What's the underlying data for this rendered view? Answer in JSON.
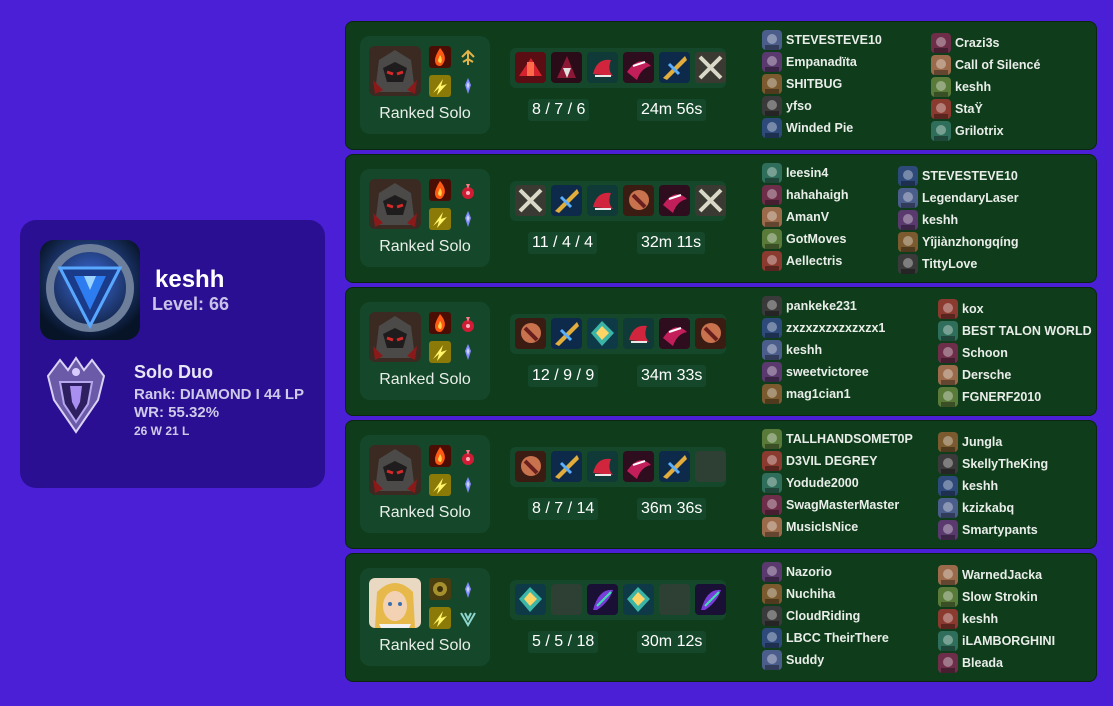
{
  "profile": {
    "name": "keshh",
    "level": "Level: 66",
    "queue": "Solo Duo",
    "rank": "Rank: DIAMOND I 44 LP",
    "winrate": "WR: 55.32%",
    "record": "26 W 21 L"
  },
  "colors": {
    "background": "#4a1fd6",
    "profile_card": "#2a0f92",
    "match_card": "#0f3d1b",
    "match_inner": "#15482a"
  },
  "matches": [
    {
      "queue": "Ranked Solo",
      "champion_icon": "armored-champion-portrait",
      "spells": [
        "ignite-icon",
        "flash-icon"
      ],
      "runes": [
        "precision-rune-icon",
        "sorcery-rune-icon"
      ],
      "items": [
        "item-red",
        "item-dark-red",
        "item-green",
        "item-crimson",
        "item-blue",
        "item-blades"
      ],
      "kda": "8 / 7 / 6",
      "duration": "24m 56s",
      "team_a": [
        "STEVESTEVE10",
        "Empanadïta",
        "SHITBUG",
        "yfso",
        "Winded Pie"
      ],
      "team_b": [
        "Crazi3s",
        "Call of Silencé",
        "keshh",
        "StaŸ",
        "Grilotrix"
      ]
    },
    {
      "queue": "Ranked Solo",
      "champion_icon": "armored-champion-portrait",
      "spells": [
        "ignite-icon",
        "flash-icon"
      ],
      "runes": [
        "domination-rune-icon",
        "sorcery-rune-icon"
      ],
      "items": [
        "item-blades",
        "item-blue",
        "item-green",
        "item-orange",
        "item-crimson",
        "item-blades"
      ],
      "kda": "11 / 4 / 4",
      "duration": "32m 11s",
      "team_a": [
        "leesin4",
        "hahahaigh",
        "AmanV",
        "GotMoves",
        "Aellectris"
      ],
      "team_b": [
        "STEVESTEVE10",
        "LegendaryLaser",
        "keshh",
        "Yîjiànzhongqíng",
        "TittyLove"
      ]
    },
    {
      "queue": "Ranked Solo",
      "champion_icon": "armored-champion-portrait",
      "spells": [
        "ignite-icon",
        "flash-icon"
      ],
      "runes": [
        "domination-rune-icon",
        "sorcery-rune-icon"
      ],
      "items": [
        "item-orange",
        "item-blue",
        "item-teal",
        "item-green",
        "item-crimson",
        "item-orange"
      ],
      "kda": "12 / 9 / 9",
      "duration": "34m 33s",
      "team_a": [
        "pankeke231",
        "zxzxzxzxzxzxzx1",
        "keshh",
        "sweetvictoree",
        "mag1cian1"
      ],
      "team_b": [
        "kox",
        "BEST TALON WORLD",
        "Schoon",
        "Dersche",
        "FGNERF2010"
      ]
    },
    {
      "queue": "Ranked Solo",
      "champion_icon": "armored-champion-portrait",
      "spells": [
        "ignite-icon",
        "flash-icon"
      ],
      "runes": [
        "domination-rune-icon",
        "sorcery-rune-icon"
      ],
      "items": [
        "item-orange",
        "item-blue",
        "item-green",
        "item-crimson",
        "item-blue",
        ""
      ],
      "kda": "8 / 7 / 14",
      "duration": "36m 36s",
      "team_a": [
        "TALLHANDSOMET0P",
        "D3VIL DEGREY",
        "Yodude2000",
        "SwagMasterMaster",
        "MusicIsNice"
      ],
      "team_b": [
        "Jungla",
        "SkellyTheKing",
        "keshh",
        "kzizkabq",
        "Smartypants"
      ]
    },
    {
      "queue": "Ranked Solo",
      "champion_icon": "blonde-champion-portrait",
      "spells": [
        "exhaust-icon",
        "flash-icon"
      ],
      "runes": [
        "sorcery-rune-icon",
        "inspiration-rune-icon"
      ],
      "items": [
        "item-teal",
        "",
        "item-purple",
        "item-teal",
        "",
        "item-purple"
      ],
      "kda": "5 / 5 / 18",
      "duration": "30m 12s",
      "team_a": [
        "Nazorio",
        "Nuchiha",
        "CloudRiding",
        "LBCC TheirThere",
        "Suddy"
      ],
      "team_b": [
        "WarnedJacka",
        "Slow Strokin",
        "keshh",
        "iLAMBORGHINI",
        "Bleada"
      ]
    }
  ]
}
